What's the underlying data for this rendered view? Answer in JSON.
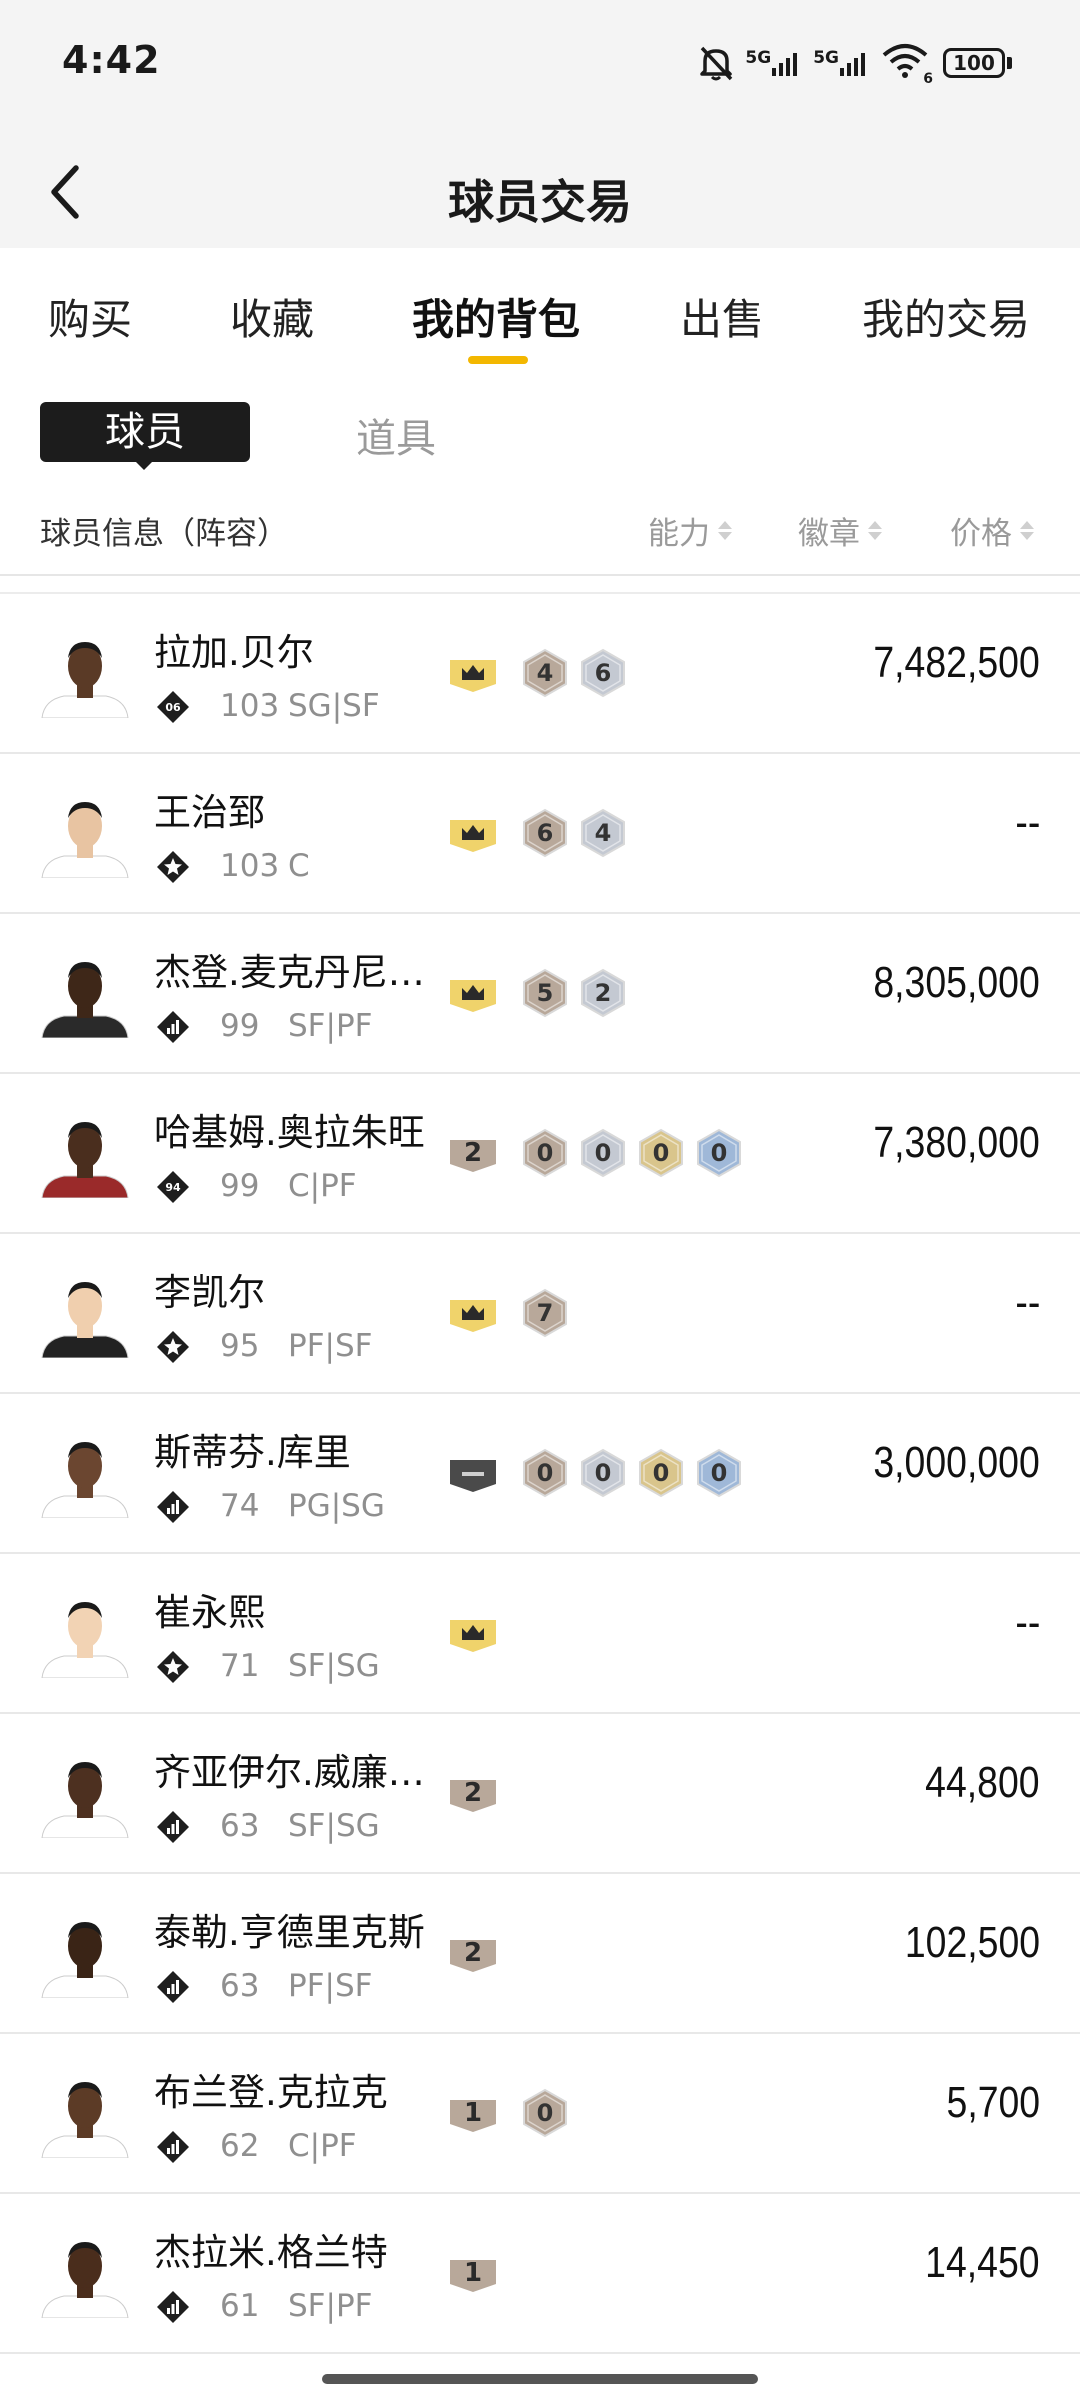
{
  "status_bar": {
    "time": "4:42",
    "net1": "5G",
    "net2": "5G",
    "wifi_label": "6",
    "battery": "100"
  },
  "header": {
    "title": "球员交易"
  },
  "main_tabs": [
    {
      "label": "购买",
      "active": false
    },
    {
      "label": "收藏",
      "active": false
    },
    {
      "label": "我的背包",
      "active": true
    },
    {
      "label": "出售",
      "active": false
    },
    {
      "label": "我的交易",
      "active": false
    }
  ],
  "sub_tabs": [
    {
      "label": "球员",
      "active": true
    },
    {
      "label": "道具",
      "active": false
    }
  ],
  "columns": {
    "info": "球员信息（阵容）",
    "ability": "能力",
    "badge": "徽章",
    "price": "价格"
  },
  "colors": {
    "accent": "#f3b700",
    "crown_badge": "#f0d36b",
    "bronze_badge": "#b8a89a",
    "silver_badge": "#c4c9d2",
    "gold_badge": "#d9c58c",
    "blue_badge": "#9fb8d8",
    "dark_badge": "#4a4a4a"
  },
  "players": [
    {
      "name": "拉加.贝尔",
      "rank": "06",
      "rank_type": "number",
      "rating": "103",
      "position": "SG|SF",
      "badges": [
        {
          "type": "crown",
          "text": ""
        },
        {
          "type": "bronze",
          "text": "4"
        },
        {
          "type": "silver",
          "text": "6"
        }
      ],
      "price": "7,482,500"
    },
    {
      "name": "王治郅",
      "rank": "",
      "rank_type": "star",
      "rating": "103",
      "position": "C",
      "badges": [
        {
          "type": "crown",
          "text": ""
        },
        {
          "type": "bronze",
          "text": "6"
        },
        {
          "type": "silver",
          "text": "4"
        }
      ],
      "price": "--"
    },
    {
      "name": "杰登.麦克丹尼…",
      "rank": "",
      "rank_type": "bars",
      "rating": "99",
      "position": "SF|PF",
      "badges": [
        {
          "type": "crown",
          "text": ""
        },
        {
          "type": "bronze",
          "text": "5"
        },
        {
          "type": "silver",
          "text": "2"
        }
      ],
      "price": "8,305,000"
    },
    {
      "name": "哈基姆.奥拉朱旺",
      "rank": "94",
      "rank_type": "number",
      "rating": "99",
      "position": "C|PF",
      "badges": [
        {
          "type": "level",
          "text": "2"
        },
        {
          "type": "bronze",
          "text": "0"
        },
        {
          "type": "silver",
          "text": "0"
        },
        {
          "type": "gold",
          "text": "0"
        },
        {
          "type": "blue",
          "text": "0"
        }
      ],
      "price": "7,380,000"
    },
    {
      "name": "李凯尔",
      "rank": "",
      "rank_type": "star",
      "rating": "95",
      "position": "PF|SF",
      "badges": [
        {
          "type": "crown",
          "text": ""
        },
        {
          "type": "bronze",
          "text": "7"
        }
      ],
      "price": "--"
    },
    {
      "name": "斯蒂芬.库里",
      "rank": "",
      "rank_type": "bars",
      "rating": "74",
      "position": "PG|SG",
      "badges": [
        {
          "type": "dark",
          "text": "—"
        },
        {
          "type": "bronze",
          "text": "0"
        },
        {
          "type": "silver",
          "text": "0"
        },
        {
          "type": "gold",
          "text": "0"
        },
        {
          "type": "blue",
          "text": "0"
        }
      ],
      "price": "3,000,000"
    },
    {
      "name": "崔永熙",
      "rank": "",
      "rank_type": "star",
      "rating": "71",
      "position": "SF|SG",
      "badges": [
        {
          "type": "crown",
          "text": ""
        }
      ],
      "price": "--"
    },
    {
      "name": "齐亚伊尔.威廉…",
      "rank": "",
      "rank_type": "bars",
      "rating": "63",
      "position": "SF|SG",
      "badges": [
        {
          "type": "level",
          "text": "2"
        }
      ],
      "price": "44,800"
    },
    {
      "name": "泰勒.亨德里克斯",
      "rank": "",
      "rank_type": "bars",
      "rating": "63",
      "position": "PF|SF",
      "badges": [
        {
          "type": "level",
          "text": "2"
        }
      ],
      "price": "102,500"
    },
    {
      "name": "布兰登.克拉克",
      "rank": "",
      "rank_type": "bars",
      "rating": "62",
      "position": "C|PF",
      "badges": [
        {
          "type": "level",
          "text": "1"
        },
        {
          "type": "bronze",
          "text": "0"
        }
      ],
      "price": "5,700"
    },
    {
      "name": "杰拉米.格兰特",
      "rank": "",
      "rank_type": "bars",
      "rating": "61",
      "position": "SF|PF",
      "badges": [
        {
          "type": "level",
          "text": "1"
        }
      ],
      "price": "14,450"
    }
  ]
}
